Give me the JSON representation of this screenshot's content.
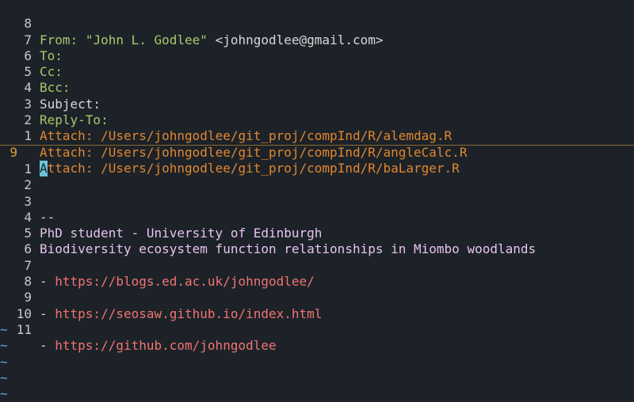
{
  "editor": {
    "header_lines": [
      {
        "num": "8",
        "key": "From:",
        "quoted": "\"John L. Godlee\"",
        "rest": " <johngodlee@gmail.com>"
      },
      {
        "num": "7",
        "key": "To:"
      },
      {
        "num": "6",
        "key": "Cc:"
      },
      {
        "num": "5",
        "key": "Bcc:"
      },
      {
        "num": "4",
        "key": "Subject:"
      },
      {
        "num": "3",
        "key": "Reply-To:"
      },
      {
        "num": "2",
        "key": "Attach:",
        "path": " /Users/johngodlee/git_proj/compInd/R/alemdag.R"
      },
      {
        "num": "1",
        "key": "Attach:",
        "path": " /Users/johngodlee/git_proj/compInd/R/angleCalc.R"
      }
    ],
    "current_line": {
      "num": "9",
      "cursor_char": "A",
      "key_rest": "ttach:",
      "path": " /Users/johngodlee/git_proj/compInd/R/baLarger.R"
    },
    "body_lines": [
      {
        "num": "1",
        "text": ""
      },
      {
        "num": "2",
        "text": ""
      },
      {
        "num": "3",
        "text": "--"
      },
      {
        "num": "4",
        "text": "PhD student - University of Edinburgh"
      },
      {
        "num": "5",
        "text": "Biodiversity ecosystem function relationships in Miombo woodlands"
      },
      {
        "num": "6",
        "text": ""
      },
      {
        "num": "7",
        "prefix": "- ",
        "url": "https://blogs.ed.ac.uk/johngodlee/"
      },
      {
        "num": "8",
        "text": ""
      },
      {
        "num": "9",
        "prefix": "- ",
        "url": "https://seosaw.github.io/index.html"
      },
      {
        "num": "10",
        "text": ""
      },
      {
        "num": "11",
        "prefix": "- ",
        "url": "https://github.com/johngodlee"
      }
    ],
    "tilde": "~",
    "colors": {
      "background": "#1d2229",
      "header_key": "#a6c86a",
      "attach": "#e0872e",
      "signature": "#e6c3ee",
      "url": "#f07470",
      "line_number": "#c9c9c9",
      "current_line_number": "#e0a030",
      "cursor": "#6cc4d8",
      "tilde": "#6aa6c8"
    }
  }
}
